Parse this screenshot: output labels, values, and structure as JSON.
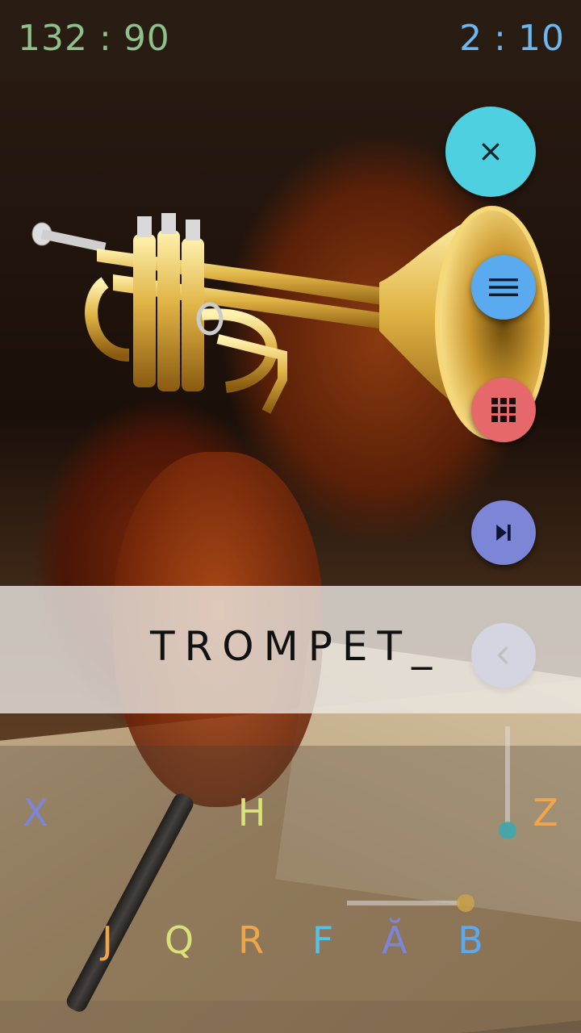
{
  "score": {
    "left_a": "132",
    "left_b": "90",
    "right_a": "2",
    "right_b": "10",
    "separator": ":"
  },
  "buttons": {
    "close_icon": "close-icon",
    "menu_icon": "menu-icon",
    "grid_icon": "grid-icon",
    "skip_icon": "skip-next-icon",
    "back_icon": "chevron-left-icon"
  },
  "answer": "TROMPET_",
  "letters": [
    {
      "char": "X",
      "color": "#7d86d6"
    },
    {
      "char": "H",
      "color": "#d8e27a"
    },
    {
      "char": "Z",
      "color": "#f0a54a"
    },
    {
      "char": "J",
      "color": "#f0a54a"
    },
    {
      "char": "Q",
      "color": "#d8e27a"
    },
    {
      "char": "R",
      "color": "#f0a54a"
    },
    {
      "char": "F",
      "color": "#4fc3e8"
    },
    {
      "char": "Ă",
      "color": "#7d86d6"
    },
    {
      "char": "B",
      "color": "#5aaaf0"
    }
  ],
  "colors": {
    "score_left": "#8fc08c",
    "score_right": "#6fb6ee",
    "close": "#4fd0e0",
    "menu": "#5aaaf0",
    "grid": "#e7686a",
    "skip": "#7d86d6",
    "back": "#7d86d6"
  }
}
